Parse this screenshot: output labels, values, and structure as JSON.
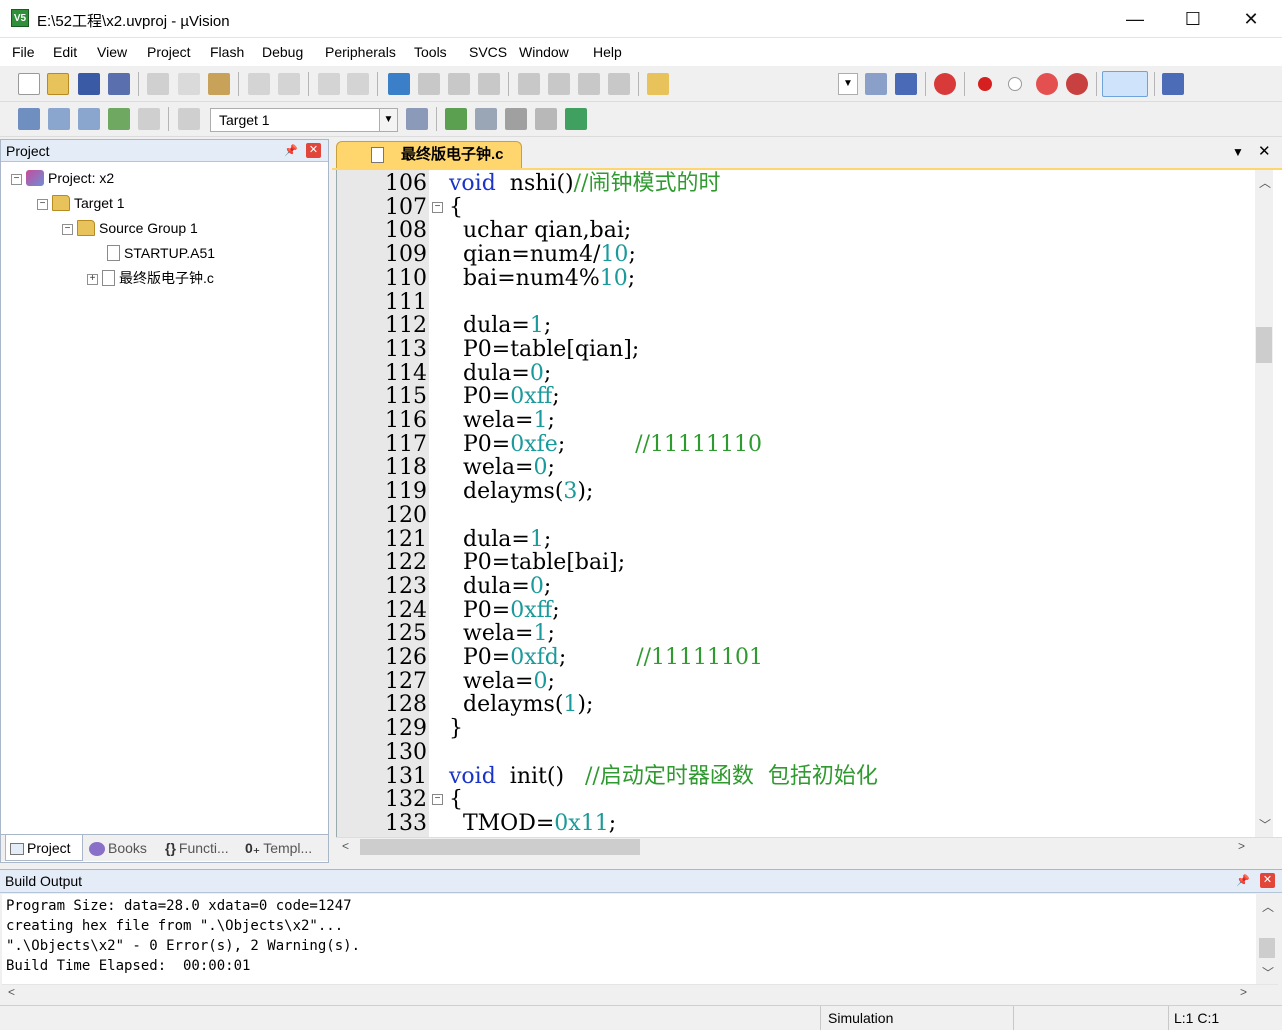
{
  "window": {
    "title": "E:\\52工程\\x2.uvproj - µVision",
    "app_icon_text": "V5",
    "minimize": "—",
    "maximize": "☐",
    "close": "✕"
  },
  "menu": [
    "File",
    "Edit",
    "View",
    "Project",
    "Flash",
    "Debug",
    "Peripherals",
    "Tools",
    "SVCS",
    "Window",
    "Help"
  ],
  "toolbar2": {
    "target_select": "Target 1"
  },
  "project_pane": {
    "title": "Project",
    "tree": [
      {
        "label": "Project: x2",
        "level": 0,
        "expander": "−",
        "icon": "project-icon"
      },
      {
        "label": "Target 1",
        "level": 1,
        "expander": "−",
        "icon": "target-folder-icon"
      },
      {
        "label": "Source Group 1",
        "level": 2,
        "expander": "−",
        "icon": "folder-icon"
      },
      {
        "label": "STARTUP.A51",
        "level": 3,
        "expander": "",
        "icon": "file-icon"
      },
      {
        "label": "最终版电子钟.c",
        "level": 3,
        "expander": "+",
        "icon": "file-icon"
      }
    ],
    "tabs": [
      "Project",
      "Books",
      "Functi...",
      "Templ..."
    ]
  },
  "editor": {
    "tab_label": "最终版电子钟.c",
    "lines": [
      {
        "n": "106",
        "fold": "",
        "code": [
          [
            "kw",
            "void"
          ],
          [
            "",
            "  nshi()"
          ],
          [
            "cm",
            "//闹钟模式的时"
          ]
        ]
      },
      {
        "n": "107",
        "fold": "−",
        "code": [
          [
            "",
            "{"
          ]
        ]
      },
      {
        "n": "108",
        "fold": "",
        "code": [
          [
            "",
            "  uchar qian,bai;"
          ]
        ]
      },
      {
        "n": "109",
        "fold": "",
        "code": [
          [
            "",
            "  qian=num4/"
          ],
          [
            "num",
            "10"
          ],
          [
            "",
            ";"
          ]
        ]
      },
      {
        "n": "110",
        "fold": "",
        "code": [
          [
            "",
            "  bai=num4%"
          ],
          [
            "num",
            "10"
          ],
          [
            "",
            ";"
          ]
        ]
      },
      {
        "n": "111",
        "fold": "",
        "code": [
          [
            "",
            ""
          ]
        ]
      },
      {
        "n": "112",
        "fold": "",
        "code": [
          [
            "",
            "  dula="
          ],
          [
            "num",
            "1"
          ],
          [
            "",
            ";"
          ]
        ]
      },
      {
        "n": "113",
        "fold": "",
        "code": [
          [
            "",
            "  P0=table[qian];"
          ]
        ]
      },
      {
        "n": "114",
        "fold": "",
        "code": [
          [
            "",
            "  dula="
          ],
          [
            "num",
            "0"
          ],
          [
            "",
            ";"
          ]
        ]
      },
      {
        "n": "115",
        "fold": "",
        "code": [
          [
            "",
            "  P0="
          ],
          [
            "num",
            "0xff"
          ],
          [
            "",
            ";"
          ]
        ]
      },
      {
        "n": "116",
        "fold": "",
        "code": [
          [
            "",
            "  wela="
          ],
          [
            "num",
            "1"
          ],
          [
            "",
            ";"
          ]
        ]
      },
      {
        "n": "117",
        "fold": "",
        "code": [
          [
            "",
            "  P0="
          ],
          [
            "num",
            "0xfe"
          ],
          [
            "",
            ";          "
          ],
          [
            "cm",
            "//11111110"
          ]
        ]
      },
      {
        "n": "118",
        "fold": "",
        "code": [
          [
            "",
            "  wela="
          ],
          [
            "num",
            "0"
          ],
          [
            "",
            ";"
          ]
        ]
      },
      {
        "n": "119",
        "fold": "",
        "code": [
          [
            "",
            "  delayms("
          ],
          [
            "num",
            "3"
          ],
          [
            "",
            ");"
          ]
        ]
      },
      {
        "n": "120",
        "fold": "",
        "code": [
          [
            "",
            ""
          ]
        ]
      },
      {
        "n": "121",
        "fold": "",
        "code": [
          [
            "",
            "  dula="
          ],
          [
            "num",
            "1"
          ],
          [
            "",
            ";"
          ]
        ]
      },
      {
        "n": "122",
        "fold": "",
        "code": [
          [
            "",
            "  P0=table[bai];"
          ]
        ]
      },
      {
        "n": "123",
        "fold": "",
        "code": [
          [
            "",
            "  dula="
          ],
          [
            "num",
            "0"
          ],
          [
            "",
            ";"
          ]
        ]
      },
      {
        "n": "124",
        "fold": "",
        "code": [
          [
            "",
            "  P0="
          ],
          [
            "num",
            "0xff"
          ],
          [
            "",
            ";"
          ]
        ]
      },
      {
        "n": "125",
        "fold": "",
        "code": [
          [
            "",
            "  wela="
          ],
          [
            "num",
            "1"
          ],
          [
            "",
            ";"
          ]
        ]
      },
      {
        "n": "126",
        "fold": "",
        "code": [
          [
            "",
            "  P0="
          ],
          [
            "num",
            "0xfd"
          ],
          [
            "",
            ";          "
          ],
          [
            "cm",
            "//11111101"
          ]
        ]
      },
      {
        "n": "127",
        "fold": "",
        "code": [
          [
            "",
            "  wela="
          ],
          [
            "num",
            "0"
          ],
          [
            "",
            ";"
          ]
        ]
      },
      {
        "n": "128",
        "fold": "",
        "code": [
          [
            "",
            "  delayms("
          ],
          [
            "num",
            "1"
          ],
          [
            "",
            ");"
          ]
        ]
      },
      {
        "n": "129",
        "fold": "",
        "code": [
          [
            "",
            "}"
          ]
        ]
      },
      {
        "n": "130",
        "fold": "",
        "code": [
          [
            "",
            ""
          ]
        ]
      },
      {
        "n": "131",
        "fold": "",
        "code": [
          [
            "kw",
            "void"
          ],
          [
            "",
            "  init()   "
          ],
          [
            "cm",
            "//启动定时器函数  包括初始化"
          ]
        ]
      },
      {
        "n": "132",
        "fold": "−",
        "code": [
          [
            "",
            "{"
          ]
        ]
      },
      {
        "n": "133",
        "fold": "",
        "code": [
          [
            "",
            "  TMOD="
          ],
          [
            "num",
            "0x11"
          ],
          [
            "",
            ";"
          ]
        ]
      }
    ]
  },
  "build_output": {
    "title": "Build Output",
    "lines": [
      "Program Size: data=28.0 xdata=0 code=1247",
      "creating hex file from \".\\Objects\\x2\"...",
      "\".\\Objects\\x2\" - 0 Error(s), 2 Warning(s).",
      "Build Time Elapsed:  00:00:01"
    ]
  },
  "status": {
    "mode": "Simulation",
    "position": "L:1 C:1"
  },
  "colors": {
    "keyword": "#1a33c9",
    "number": "#1a9a9a",
    "comment": "#2f9a2f",
    "active_tab": "#ffd56d",
    "pane_header": "#e4ecf7"
  }
}
